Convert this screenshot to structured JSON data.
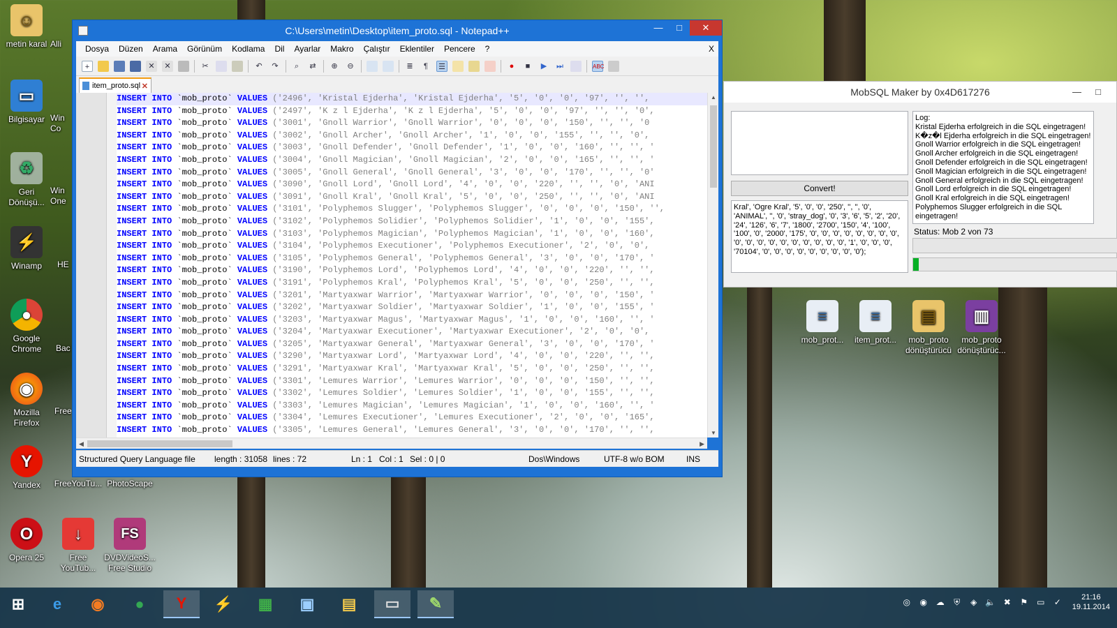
{
  "desktop": {
    "icons": [
      {
        "label": "metin karal"
      },
      {
        "label": "Bilgisayar"
      },
      {
        "label": "Geri Dönüşü..."
      },
      {
        "label": "Winamp"
      },
      {
        "label": "Google Chrome"
      },
      {
        "label": "Mozilla Firefox"
      },
      {
        "label": "Yandex"
      },
      {
        "label": "Opera 25"
      },
      {
        "label": "Free YouTub..."
      },
      {
        "label": "DVDVideoS... Free Studio"
      },
      {
        "label": "FreeYouTu..."
      },
      {
        "label": "PhotoScape"
      },
      {
        "label": "Alli"
      },
      {
        "label": "Win Co"
      },
      {
        "label": "Win One"
      },
      {
        "label": "HE"
      },
      {
        "label": "Bac"
      },
      {
        "label": "Free"
      }
    ],
    "right_icons": [
      {
        "label": "mob_prot..."
      },
      {
        "label": "item_prot..."
      },
      {
        "label": "mob_proto dönüştürücü"
      },
      {
        "label": "mob_proto dönüştürüc..."
      }
    ]
  },
  "npp": {
    "title": "C:\\Users\\metin\\Desktop\\item_proto.sql - Notepad++",
    "window_buttons": {
      "minimize": "—",
      "maximize": "□",
      "close": "✕"
    },
    "menu": [
      "Dosya",
      "Düzen",
      "Arama",
      "Görünüm",
      "Kodlama",
      "Dil",
      "Ayarlar",
      "Makro",
      "Çalıştır",
      "Eklentiler",
      "Pencere",
      "?"
    ],
    "menu_close": "X",
    "tab_label": "item_proto.sql",
    "lines": [
      {
        "n": "1",
        "rest": "('2496', 'Kristal Ejderha', 'Kristal Ejderha', '5', '0', '0', '97', '', '',"
      },
      {
        "n": "2",
        "rest": "('2497', 'K z l Ejderha', 'K z l Ejderha', '5', '0', '0', '97', '', '', '0',"
      },
      {
        "n": "3",
        "rest": "('3001', 'Gnoll Warrior', 'Gnoll Warrior', '0', '0', '0', '150', '', '', '0"
      },
      {
        "n": "4",
        "rest": "('3002', 'Gnoll Archer', 'Gnoll Archer', '1', '0', '0', '155', '', '', '0',"
      },
      {
        "n": "5",
        "rest": "('3003', 'Gnoll Defender', 'Gnoll Defender', '1', '0', '0', '160', '', '', '"
      },
      {
        "n": "6",
        "rest": "('3004', 'Gnoll Magician', 'Gnoll Magician', '2', '0', '0', '165', '', '', '"
      },
      {
        "n": "7",
        "rest": "('3005', 'Gnoll General', 'Gnoll General', '3', '0', '0', '170', '', '', '0'"
      },
      {
        "n": "8",
        "rest": "('3090', 'Gnoll Lord', 'Gnoll Lord', '4', '0', '0', '220', '', '', '0', 'ANI"
      },
      {
        "n": "9",
        "rest": "('3091', 'Gnoll Kral', 'Gnoll Kral', '5', '0', '0', '250', '', '', '0', 'ANI"
      },
      {
        "n": "10",
        "rest": "('3101', 'Polyphemos Slugger', 'Polyphemos Slugger', '0', '0', '0', '150', '',"
      },
      {
        "n": "11",
        "rest": "('3102', 'Polyphemos Solidier', 'Polyphemos Solidier', '1', '0', '0', '155',"
      },
      {
        "n": "12",
        "rest": "('3103', 'Polyphemos Magician', 'Polyphemos Magician', '1', '0', '0', '160',"
      },
      {
        "n": "13",
        "rest": "('3104', 'Polyphemos Executioner', 'Polyphemos Executioner', '2', '0', '0',"
      },
      {
        "n": "14",
        "rest": "('3105', 'Polyphemos General', 'Polyphemos General', '3', '0', '0', '170', '"
      },
      {
        "n": "15",
        "rest": "('3190', 'Polyphemos Lord', 'Polyphemos Lord', '4', '0', '0', '220', '', '',"
      },
      {
        "n": "16",
        "rest": "('3191', 'Polyphemos Kral', 'Polyphemos Kral', '5', '0', '0', '250', '', '',"
      },
      {
        "n": "17",
        "rest": "('3201', 'Martyaxwar Warrior', 'Martyaxwar Warrior', '0', '0', '0', '150', '"
      },
      {
        "n": "18",
        "rest": "('3202', 'Martyaxwar Soldier', 'Martyaxwar Soldier', '1', '0', '0', '155', '"
      },
      {
        "n": "19",
        "rest": "('3203', 'Martyaxwar Magus', 'Martyaxwar Magus', '1', '0', '0', '160', '', '"
      },
      {
        "n": "20",
        "rest": "('3204', 'Martyaxwar Executioner', 'Martyaxwar Executioner', '2', '0', '0',"
      },
      {
        "n": "21",
        "rest": "('3205', 'Martyaxwar General', 'Martyaxwar General', '3', '0', '0', '170', '"
      },
      {
        "n": "22",
        "rest": "('3290', 'Martyaxwar Lord', 'Martyaxwar Lord', '4', '0', '0', '220', '', '',"
      },
      {
        "n": "23",
        "rest": "('3291', 'Martyaxwar Kral', 'Martyaxwar Kral', '5', '0', '0', '250', '', '',"
      },
      {
        "n": "24",
        "rest": "('3301', 'Lemures Warrior', 'Lemures Warrior', '0', '0', '0', '150', '', '',"
      },
      {
        "n": "25",
        "rest": "('3302', 'Lemures Soldier', 'Lemures Soldier', '1', '0', '0', '155', '', '',"
      },
      {
        "n": "26",
        "rest": "('3303', 'Lemures Magician', 'Lemures Magician', '1', '0', '0', '160', '', '"
      },
      {
        "n": "27",
        "rest": "('3304', 'Lemures Executioner', 'Lemures Executioner', '2', '0', '0', '165',"
      },
      {
        "n": "28",
        "rest": "('3305', 'Lemures General', 'Lemures General', '3', '0', '0', '170', '', '',"
      }
    ],
    "line_prefix": {
      "insert": "INSERT",
      "into": "INTO",
      "table": "`mob_proto`",
      "values": "VALUES"
    },
    "status": {
      "filetype": "Structured Query Language file",
      "length": "length : 31058",
      "lines": "lines : 72",
      "ln": "Ln : 1",
      "col": "Col : 1",
      "sel": "Sel : 0 | 0",
      "eol": "Dos\\Windows",
      "encoding": "UTF-8 w/o BOM",
      "mode": "INS"
    }
  },
  "mob": {
    "title": "MobSQL Maker by 0x4D617276",
    "input_text": "",
    "convert_label": "Convert!",
    "output_text": "Kral', 'Ogre Kral', '5', '0', '0', '250', '', '', '0', 'ANIMAL', '', '0', 'stray_dog', '0', '3', '6', '5', '2', '20', '24', '126', '6', '7', '1800', '2700', '150', '4', '100', '100', '0', '2000', '175', '0', '0', '0', '0', '0', '0', '0', '0', '0', '0', '0', '0', '0', '0', '0', '0', '0', '0', '1', '0', '0', '0', '70104', '0', '0', '0', '0', '0', '0', '0', '0', '0');",
    "log_title": "Log:",
    "log": [
      "Kristal Ejderha erfolgreich in die SQL eingetragen!",
      "K�z�l Ejderha erfolgreich in die SQL eingetragen!",
      "Gnoll Warrior erfolgreich in die SQL eingetragen!",
      "Gnoll Archer erfolgreich in die SQL eingetragen!",
      "Gnoll Defender erfolgreich in die SQL eingetragen!",
      "Gnoll Magician erfolgreich in die SQL eingetragen!",
      "Gnoll General erfolgreich in die SQL eingetragen!",
      "Gnoll Lord erfolgreich in die SQL eingetragen!",
      "Gnoll Kral erfolgreich in die SQL eingetragen!",
      "Polyphemos Slugger erfolgreich in die SQL eingetragen!"
    ],
    "status_text": "Status: Mob 2 von 73",
    "progress": 0.027
  },
  "taskbar": {
    "time": "21:16",
    "date": "19.11.2014"
  }
}
